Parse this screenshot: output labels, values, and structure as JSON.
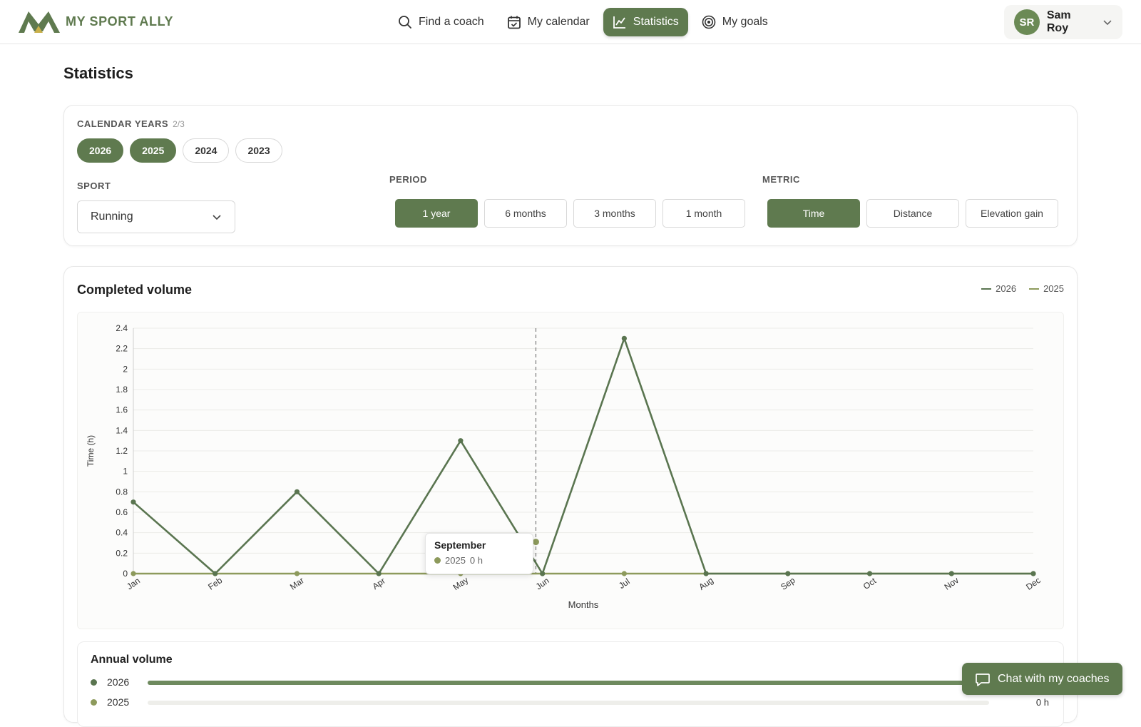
{
  "brand": {
    "name": "MY SPORT ALLY",
    "color": "#5f7a4f"
  },
  "nav": {
    "items": [
      {
        "label": "Find a coach",
        "icon": "search-icon",
        "active": false
      },
      {
        "label": "My calendar",
        "icon": "calendar-icon",
        "active": false
      },
      {
        "label": "Statistics",
        "icon": "chart-icon",
        "active": true
      },
      {
        "label": "My goals",
        "icon": "target-icon",
        "active": false
      }
    ]
  },
  "user": {
    "initials": "SR",
    "name": "Sam Roy"
  },
  "page": {
    "title": "Statistics"
  },
  "filters": {
    "years_label": "CALENDAR YEARS",
    "years_count": "2/3",
    "years": [
      {
        "label": "2026",
        "selected": true
      },
      {
        "label": "2025",
        "selected": true
      },
      {
        "label": "2024",
        "selected": false
      },
      {
        "label": "2023",
        "selected": false
      }
    ],
    "sport_label": "SPORT",
    "sport_value": "Running",
    "period_label": "PERIOD",
    "periods": [
      {
        "label": "1 year",
        "selected": true
      },
      {
        "label": "6 months",
        "selected": false
      },
      {
        "label": "3 months",
        "selected": false
      },
      {
        "label": "1 month",
        "selected": false
      }
    ],
    "metric_label": "METRIC",
    "metrics": [
      {
        "label": "Time",
        "selected": true
      },
      {
        "label": "Distance",
        "selected": false
      },
      {
        "label": "Elevation gain",
        "selected": false
      }
    ]
  },
  "volume": {
    "title": "Completed volume",
    "tooltip": {
      "title": "September",
      "series": "2025",
      "value": "0 h"
    }
  },
  "chart_data": {
    "type": "line",
    "title": "Completed volume",
    "xlabel": "Months",
    "ylabel": "Time (h)",
    "ylim": [
      0,
      2.4
    ],
    "yticks": [
      "0",
      "0.2",
      "0.4",
      "0.6",
      "0.8",
      "1",
      "1.2",
      "1.4",
      "1.6",
      "1.8",
      "2",
      "2.2",
      "2.4"
    ],
    "categories": [
      "Jan",
      "Feb",
      "Mar",
      "Apr",
      "May",
      "Jun",
      "Jul",
      "Aug",
      "Sep",
      "Oct",
      "Nov",
      "Dec"
    ],
    "grid": true,
    "legend_position": "top-right",
    "series": [
      {
        "name": "2026",
        "color": "#5a7550",
        "values": [
          0.7,
          0,
          0.8,
          0,
          1.3,
          0,
          2.3,
          0,
          0,
          0,
          0,
          0
        ]
      },
      {
        "name": "2025",
        "color": "#8d9a5c",
        "values": [
          0,
          0,
          0,
          0,
          0,
          0,
          0,
          0,
          0,
          0,
          0,
          0
        ]
      }
    ]
  },
  "annual": {
    "title": "Annual volume",
    "rows": [
      {
        "year": "2026",
        "color": "#5a7550",
        "fraction": 1.0,
        "value": ""
      },
      {
        "year": "2025",
        "color": "#8d9a5c",
        "fraction": 0,
        "value": "0 h"
      }
    ]
  },
  "chat": {
    "label": "Chat with my coaches",
    "icon": "chat-icon"
  }
}
